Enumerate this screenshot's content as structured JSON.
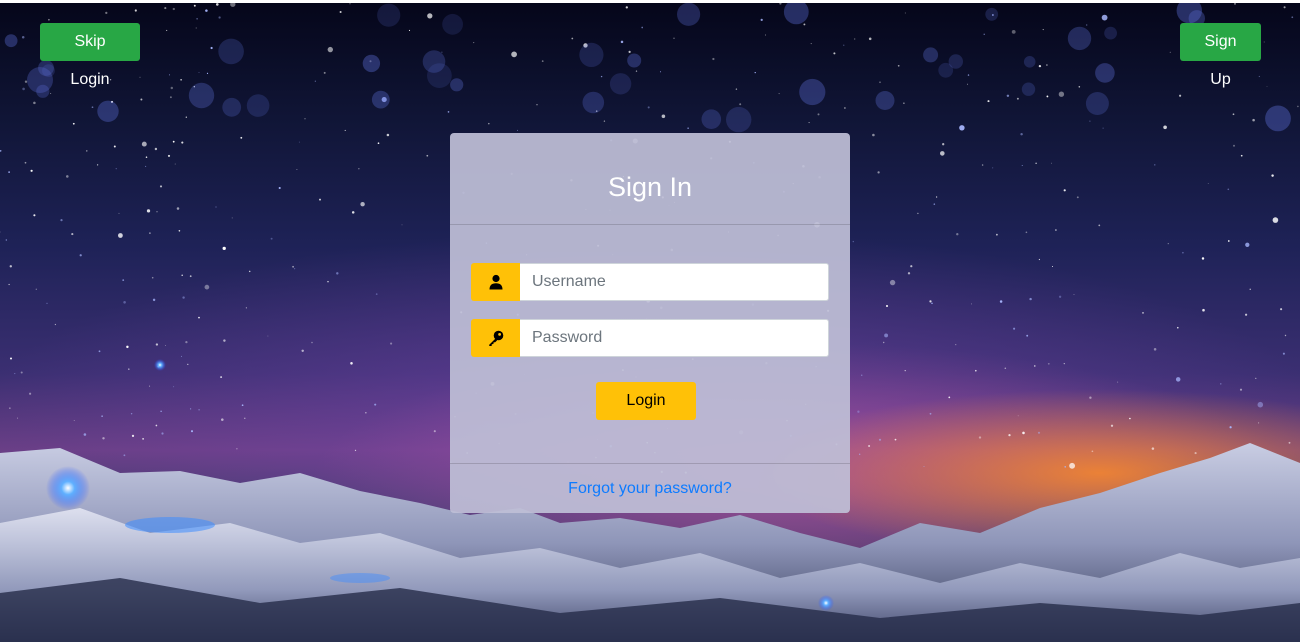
{
  "header": {
    "skip_login_label": "Skip Login",
    "sign_up_label": "Sign Up"
  },
  "login_card": {
    "title": "Sign In",
    "username": {
      "placeholder": "Username",
      "value": "",
      "icon": "user-icon"
    },
    "password": {
      "placeholder": "Password",
      "value": "",
      "icon": "key-icon"
    },
    "login_label": "Login",
    "forgot_password_label": "Forgot your password?"
  },
  "colors": {
    "green_button": "#28a745",
    "yellow_accent": "#ffc107",
    "link": "#0d7bff",
    "card_background": "#bebed6"
  }
}
